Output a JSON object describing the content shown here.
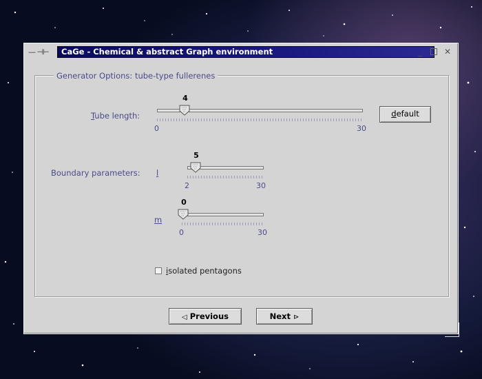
{
  "window": {
    "title": "CaGe - Chemical & abstract Graph environment",
    "left_icon": "— ⊣⊢"
  },
  "group": {
    "title": "Generator Options:  tube-type fullerenes"
  },
  "tube_length": {
    "label_mnemonic": "T",
    "label_rest": "ube length:",
    "value": "4",
    "min": "0",
    "max": "30",
    "default_mnemonic": "d",
    "default_rest": "efault"
  },
  "boundary": {
    "label": "Boundary parameters:",
    "l_label": "l",
    "l_value": "5",
    "l_min": "2",
    "l_max": "30",
    "m_label": "m",
    "m_value": "0",
    "m_min": "0",
    "m_max": "30"
  },
  "isolated": {
    "mnemonic": "i",
    "rest": "solated pentagons",
    "checked": false
  },
  "buttons": {
    "previous": "Previous",
    "previous_icon": "◁",
    "next": "Next",
    "next_icon": "⊳"
  },
  "colors": {
    "title_bar": "#0a0a5c",
    "label_text": "#4a4a8a",
    "window_bg": "#d4d4d4"
  }
}
